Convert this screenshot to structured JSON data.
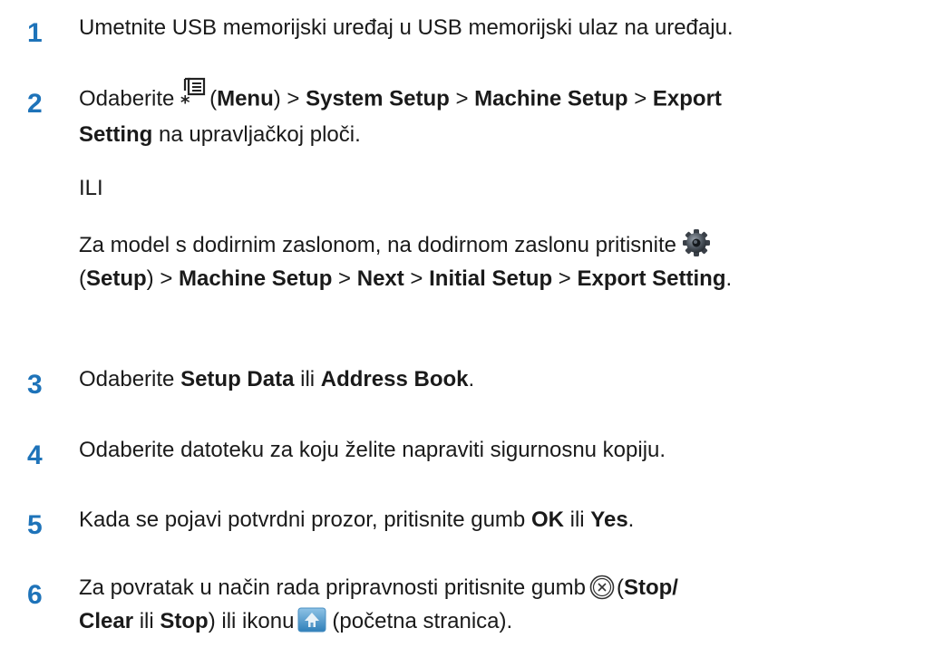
{
  "steps": [
    {
      "number": "1",
      "text": "Umetnite USB memorijski uređaj u USB memorijski ulaz na uređaju."
    },
    {
      "number": "2",
      "line1_a": "Odaberite ",
      "line1_open": "(",
      "line1_menu": "Menu",
      "line1_close": ") > ",
      "line1_system": "System Setup",
      "line1_sep1": " > ",
      "line1_machine": "Machine Setup",
      "line1_sep2": " > ",
      "line1_export": "Export",
      "line2_setting": "Setting",
      "line2_rest": " na upravljačkoj ploči.",
      "or_text": "ILI",
      "alt_line1": "Za model s dodirnim zaslonom, na dodirnom zaslonu pritisnite",
      "alt_line2_open": "(",
      "alt_line2_setup": "Setup",
      "alt_line2_close": ") > ",
      "alt_line2_machine": "Machine Setup",
      "alt_line2_sep1": " > ",
      "alt_line2_next": "Next",
      "alt_line2_sep2": " > ",
      "alt_line2_initial": "Initial Setup",
      "alt_line2_sep3": " > ",
      "alt_line2_export": "Export Setting",
      "alt_line2_end": "."
    },
    {
      "number": "3",
      "a": "Odaberite ",
      "b1": "Setup Data",
      "c": " ili ",
      "b2": "Address Book",
      "d": "."
    },
    {
      "number": "4",
      "text": "Odaberite datoteku za koju želite napraviti sigurnosnu kopiju."
    },
    {
      "number": "5",
      "a": "Kada se pojavi potvrdni prozor, pritisnite gumb ",
      "b1": "OK",
      "c": " ili ",
      "b2": "Yes",
      "d": "."
    },
    {
      "number": "6",
      "line1_a": "Za povratak u način rada pripravnosti pritisnite gumb",
      "line1_open": "(",
      "line1_stop": "Stop/",
      "line2_clear": "Clear",
      "line2_ili": " ili ",
      "line2_stop": "Stop",
      "line2_b": ") ili ikonu",
      "line2_c": "(početna stranica)."
    }
  ],
  "icons": {
    "menu": "menu-icon",
    "setup": "setup-gear-icon",
    "stop": "stop-clear-icon",
    "home": "home-icon"
  },
  "colors": {
    "step_number": "#1e73b9",
    "text": "#1a1a1a"
  }
}
